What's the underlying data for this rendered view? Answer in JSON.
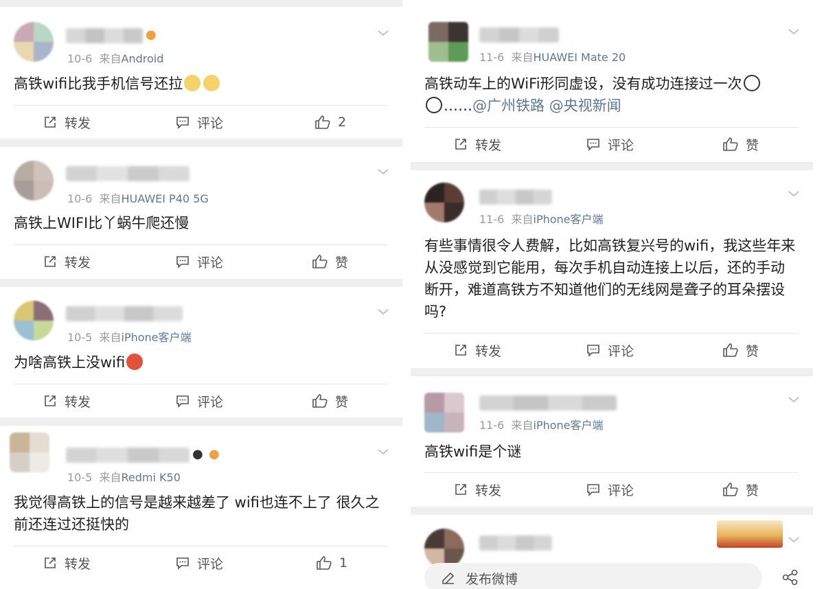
{
  "left_posts": [
    {
      "date": "10-6",
      "from_prefix": "来自",
      "source": "Android",
      "text": "高铁wifi比我手机信号还拉",
      "repost_label": "转发",
      "comment_label": "评论",
      "like_count": "2"
    },
    {
      "date": "10-6",
      "from_prefix": "来自",
      "source": "HUAWEI P40 5G",
      "text": "高铁上WIFI比丫蜗牛爬还慢",
      "repost_label": "转发",
      "comment_label": "评论",
      "like_label": "赞"
    },
    {
      "date": "10-5",
      "from_prefix": "来自",
      "source": "iPhone客户端",
      "text": "为啥高铁上没wifi",
      "repost_label": "转发",
      "comment_label": "评论",
      "like_label": "赞"
    },
    {
      "date": "10-5",
      "from_prefix": "来自",
      "source": "Redmi K50",
      "text": "我觉得高铁上的信号是越来越差了 wifi也连不上了 很久之前还连过还挺快的",
      "repost_label": "转发",
      "comment_label": "评论",
      "like_count": "1"
    }
  ],
  "right_posts": [
    {
      "date": "11-6",
      "from_prefix": "来自",
      "source": "HUAWEI Mate 20",
      "text_a": "高铁动车上的WiFi形同虚设，没有成功连接过一次",
      "text_b": "……",
      "mention1": "@广州铁路",
      "mention2": "@央视新闻",
      "repost_label": "转发",
      "comment_label": "评论",
      "like_label": "赞"
    },
    {
      "date": "11-6",
      "from_prefix": "来自",
      "source": "iPhone客户端",
      "text": "有些事情很令人费解，比如高铁复兴号的wifi，我这些年来从没感觉到它能用，每次手机自动连接上以后，还的手动断开，难道高铁方不知道他们的无线网是聋子的耳朵摆设吗?",
      "repost_label": "转发",
      "comment_label": "评论",
      "like_label": "赞"
    },
    {
      "date": "11-6",
      "from_prefix": "来自",
      "source": "iPhone客户端",
      "text": "高铁wifi是个谜",
      "repost_label": "转发",
      "comment_label": "评论",
      "like_label": "赞"
    }
  ],
  "compose": {
    "label": "发布微博"
  },
  "icons": {
    "repost": "share-out-icon",
    "comment": "comment-icon",
    "like": "thumb-up-icon",
    "chevron": "chevron-down-icon",
    "compose": "edit-icon",
    "share": "share-network-icon"
  },
  "colors": {
    "link": "#5d7894",
    "meta": "#9a9a9a",
    "separator": "#efefef"
  }
}
